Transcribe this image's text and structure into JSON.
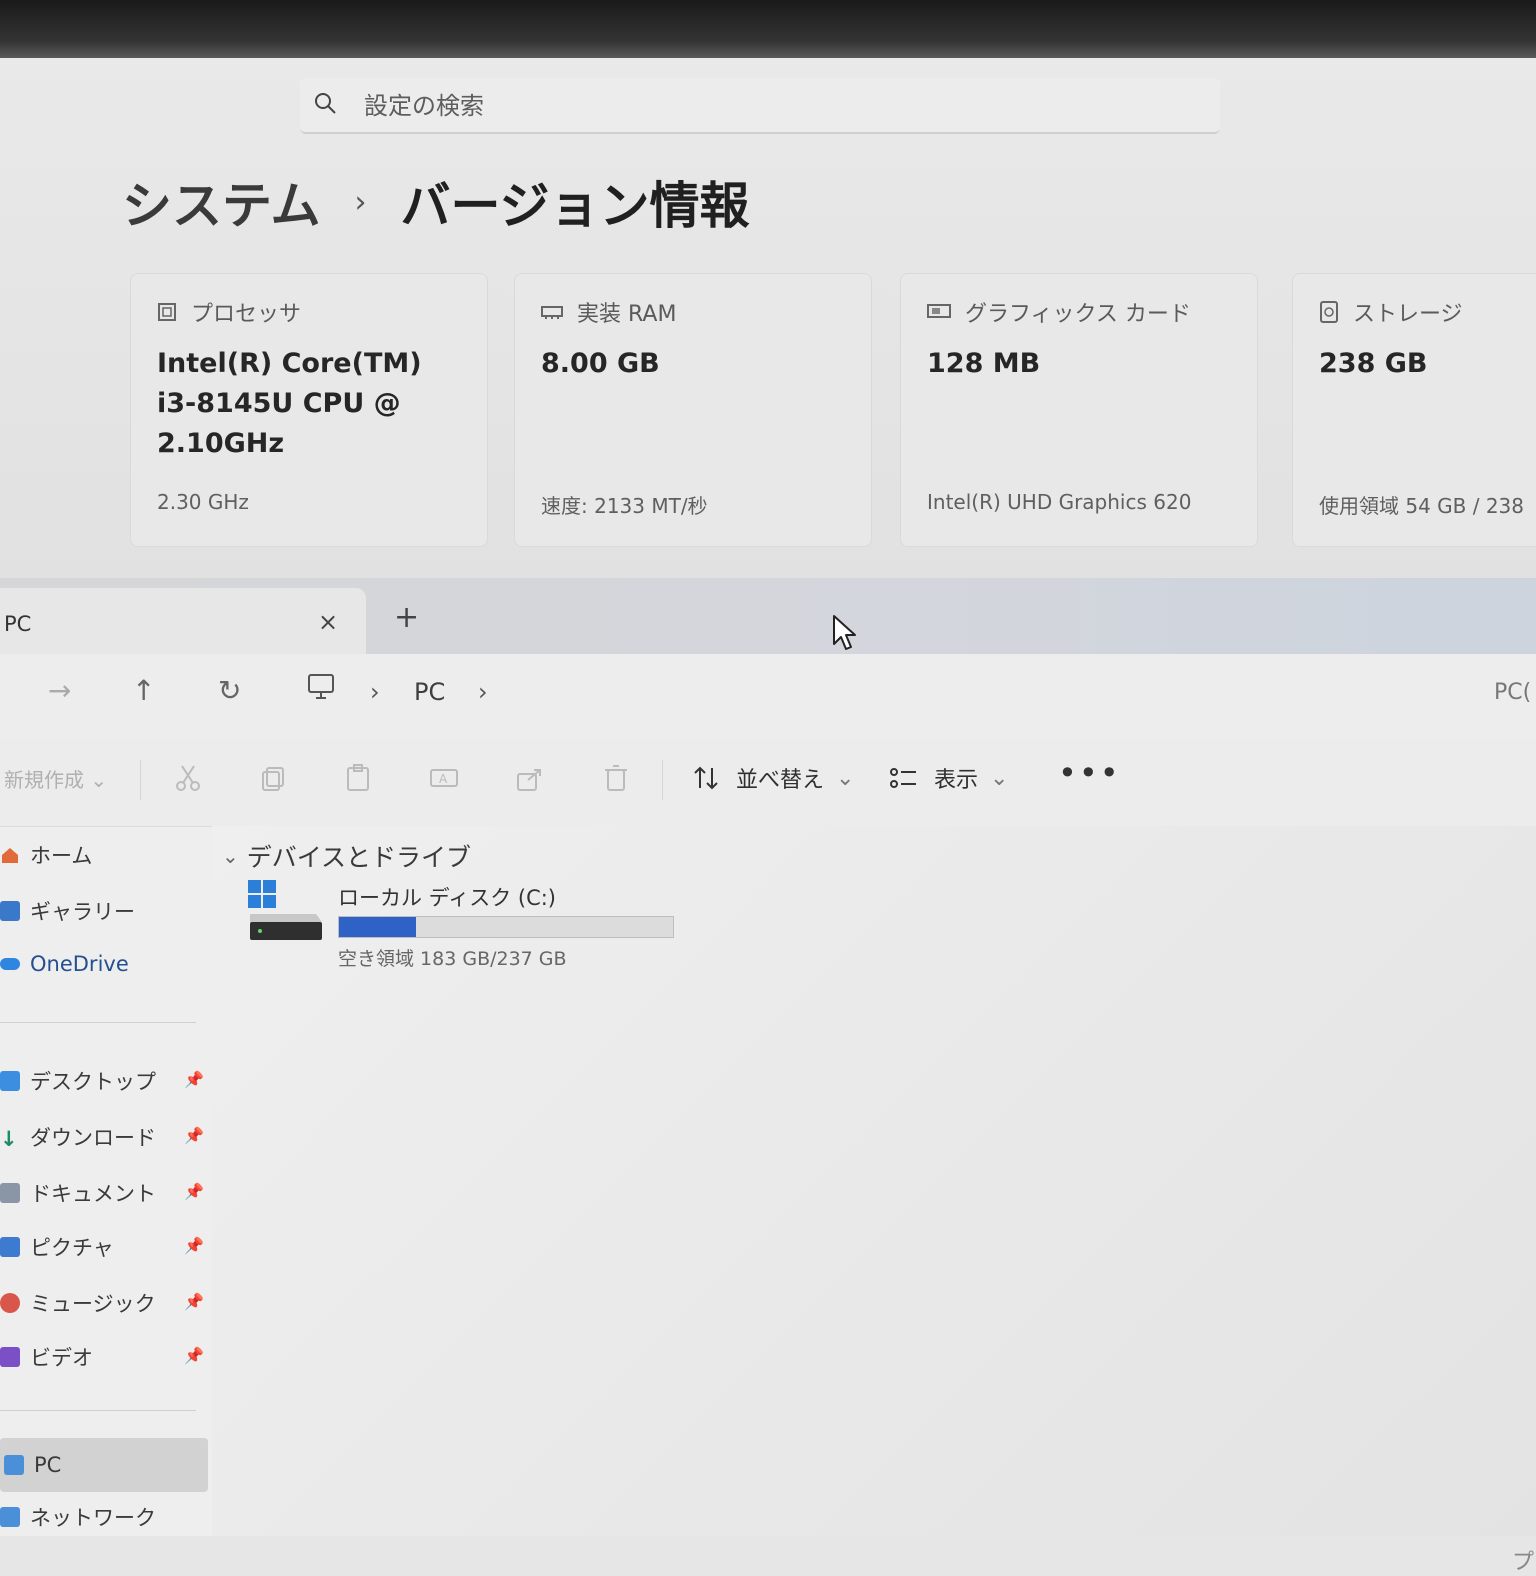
{
  "settings": {
    "search_placeholder": "設定の検索",
    "breadcrumb": {
      "parent": "システム",
      "separator": "›",
      "current": "バージョン情報"
    },
    "cards": [
      {
        "label": "プロセッサ",
        "value_lines": [
          "Intel(R) Core(TM)",
          "i3-8145U CPU @",
          "2.10GHz"
        ],
        "sub": "2.30 GHz",
        "icon": "processor-icon"
      },
      {
        "label": "実装 RAM",
        "value_lines": [
          "8.00 GB"
        ],
        "sub": "速度: 2133 MT/秒",
        "icon": "ram-icon"
      },
      {
        "label": "グラフィックス カード",
        "value_lines": [
          "128 MB"
        ],
        "sub": "Intel(R) UHD Graphics 620",
        "icon": "graphics-card-icon"
      },
      {
        "label": "ストレージ",
        "value_lines": [
          "238 GB"
        ],
        "sub": "使用領域 54 GB / 238",
        "icon": "storage-icon"
      }
    ]
  },
  "explorer": {
    "tab": {
      "title": "PC",
      "close": "×",
      "new_tab": "+"
    },
    "nav": {
      "forward": "→",
      "up": "↑",
      "refresh": "↻",
      "chevron": "›",
      "location": "PC",
      "search_hint": "PC("
    },
    "commands": {
      "new": "新規作成",
      "sort": "並べ替え",
      "view": "表示",
      "more": "•••",
      "dropdown": "⌄",
      "icons": [
        "cut-icon",
        "copy-icon",
        "paste-icon",
        "rename-icon",
        "share-icon",
        "delete-icon"
      ]
    },
    "sidebar": {
      "top": [
        "ホーム",
        "ギャラリー",
        "OneDrive"
      ],
      "quick": [
        "デスクトップ",
        "ダウンロード",
        "ドキュメント",
        "ピクチャ",
        "ミュージック",
        "ビデオ"
      ],
      "bottom": [
        "PC",
        "ネットワーク"
      ],
      "pin": "📌"
    },
    "content": {
      "group_label": "デバイスとドライブ",
      "drive": {
        "name": "ローカル ディスク (C:)",
        "free_text": "空き領域 183 GB/237 GB",
        "used_fraction": 0.23
      },
      "right_cut": "プ"
    }
  },
  "colors": {
    "drive_bar": "#2e62c6",
    "accent": "#1f6fd1"
  }
}
